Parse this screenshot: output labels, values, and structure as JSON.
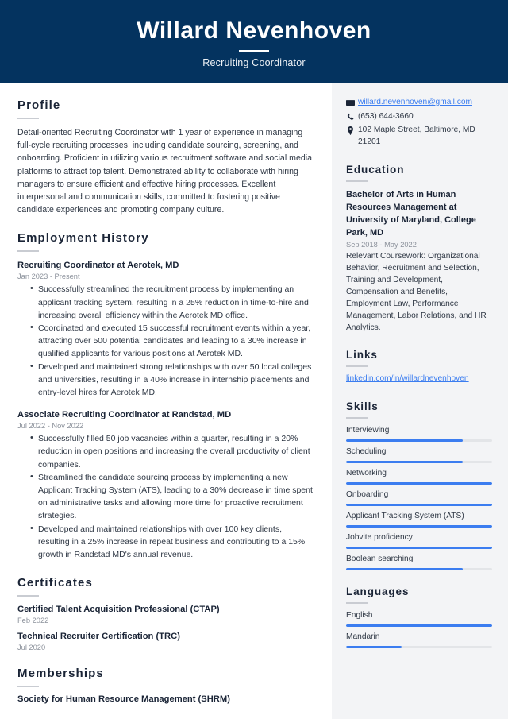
{
  "header": {
    "name": "Willard Nevenhoven",
    "job_title": "Recruiting Coordinator",
    "background_color": "#04335f"
  },
  "main": {
    "profile": {
      "heading": "Profile",
      "text": "Detail-oriented Recruiting Coordinator with 1 year of experience in managing full-cycle recruiting processes, including candidate sourcing, screening, and onboarding. Proficient in utilizing various recruitment software and social media platforms to attract top talent. Demonstrated ability to collaborate with hiring managers to ensure efficient and effective hiring processes. Excellent interpersonal and communication skills, committed to fostering positive candidate experiences and promoting company culture."
    },
    "employment": {
      "heading": "Employment History",
      "jobs": [
        {
          "title": "Recruiting Coordinator at Aerotek, MD",
          "date": "Jan 2023 - Present",
          "bullets": [
            "Successfully streamlined the recruitment process by implementing an applicant tracking system, resulting in a 25% reduction in time-to-hire and increasing overall efficiency within the Aerotek MD office.",
            "Coordinated and executed 15 successful recruitment events within a year, attracting over 500 potential candidates and leading to a 30% increase in qualified applicants for various positions at Aerotek MD.",
            "Developed and maintained strong relationships with over 50 local colleges and universities, resulting in a 40% increase in internship placements and entry-level hires for Aerotek MD."
          ]
        },
        {
          "title": "Associate Recruiting Coordinator at Randstad, MD",
          "date": "Jul 2022 - Nov 2022",
          "bullets": [
            "Successfully filled 50 job vacancies within a quarter, resulting in a 20% reduction in open positions and increasing the overall productivity of client companies.",
            "Streamlined the candidate sourcing process by implementing a new Applicant Tracking System (ATS), leading to a 30% decrease in time spent on administrative tasks and allowing more time for proactive recruitment strategies.",
            "Developed and maintained relationships with over 100 key clients, resulting in a 25% increase in repeat business and contributing to a 15% growth in Randstad MD's annual revenue."
          ]
        }
      ]
    },
    "certificates": {
      "heading": "Certificates",
      "items": [
        {
          "title": "Certified Talent Acquisition Professional (CTAP)",
          "date": "Feb 2022"
        },
        {
          "title": "Technical Recruiter Certification (TRC)",
          "date": "Jul 2020"
        }
      ]
    },
    "memberships": {
      "heading": "Memberships",
      "items": [
        {
          "title": "Society for Human Resource Management (SHRM)"
        }
      ]
    }
  },
  "aside": {
    "contact": {
      "email": "willard.nevenhoven@gmail.com",
      "email_icon": "envelope-icon",
      "phone": "(653) 644-3660",
      "phone_icon": "phone-icon",
      "address": "102 Maple Street, Baltimore, MD 21201",
      "address_icon": "location-pin-icon"
    },
    "education": {
      "heading": "Education",
      "degree": "Bachelor of Arts in Human Resources Management at University of Maryland, College Park, MD",
      "date": "Sep 2018 - May 2022",
      "description": "Relevant Coursework: Organizational Behavior, Recruitment and Selection, Training and Development, Compensation and Benefits, Employment Law, Performance Management, Labor Relations, and HR Analytics."
    },
    "links": {
      "heading": "Links",
      "items": [
        {
          "label": "linkedin.com/in/willardnevenhoven"
        }
      ]
    },
    "skills": {
      "heading": "Skills",
      "accent_color": "#3b7df0",
      "items": [
        {
          "label": "Interviewing",
          "level": 80
        },
        {
          "label": "Scheduling",
          "level": 80
        },
        {
          "label": "Networking",
          "level": 100
        },
        {
          "label": "Onboarding",
          "level": 100
        },
        {
          "label": "Applicant Tracking System (ATS)",
          "level": 100
        },
        {
          "label": "Jobvite proficiency",
          "level": 100
        },
        {
          "label": "Boolean searching",
          "level": 80
        }
      ]
    },
    "languages": {
      "heading": "Languages",
      "items": [
        {
          "label": "English",
          "level": 100
        },
        {
          "label": "Mandarin",
          "level": 38
        }
      ]
    }
  }
}
